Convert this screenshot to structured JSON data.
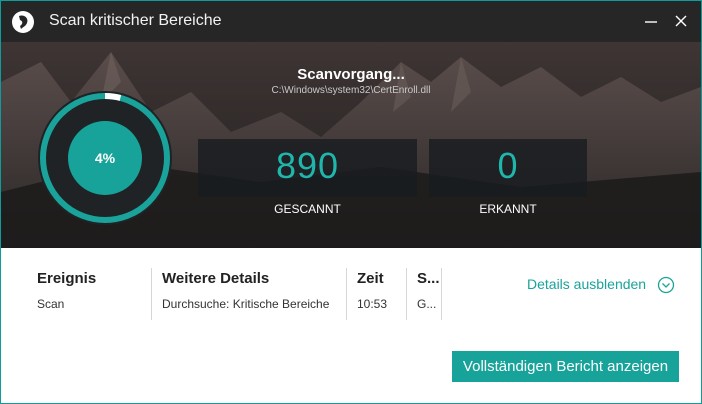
{
  "window": {
    "title": "Scan kritischer Bereiche"
  },
  "scan": {
    "status": "Scanvorgang...",
    "current_file": "C:\\Windows\\system32\\CertEnroll.dll",
    "progress_percent": 4,
    "progress_label": "4%"
  },
  "stats": {
    "scanned_value": "890",
    "scanned_label": "GESCANNT",
    "detected_value": "0",
    "detected_label": "ERKANNT"
  },
  "table": {
    "headers": [
      "Ereignis",
      "Weitere Details",
      "Zeit",
      "S..."
    ],
    "row": [
      "Scan",
      "Durchsuche: Kritische Bereiche",
      "10:53",
      "G..."
    ]
  },
  "details_toggle_label": "Details ausblenden",
  "report_button_label": "Vollständigen Bericht anzeigen",
  "colors": {
    "accent": "#17a39a",
    "titlebar": "#262626",
    "stat_text": "#1fb6ab"
  },
  "icons": [
    "app-logo-icon",
    "minimize-icon",
    "close-icon",
    "chevron-down-circle-icon"
  ]
}
